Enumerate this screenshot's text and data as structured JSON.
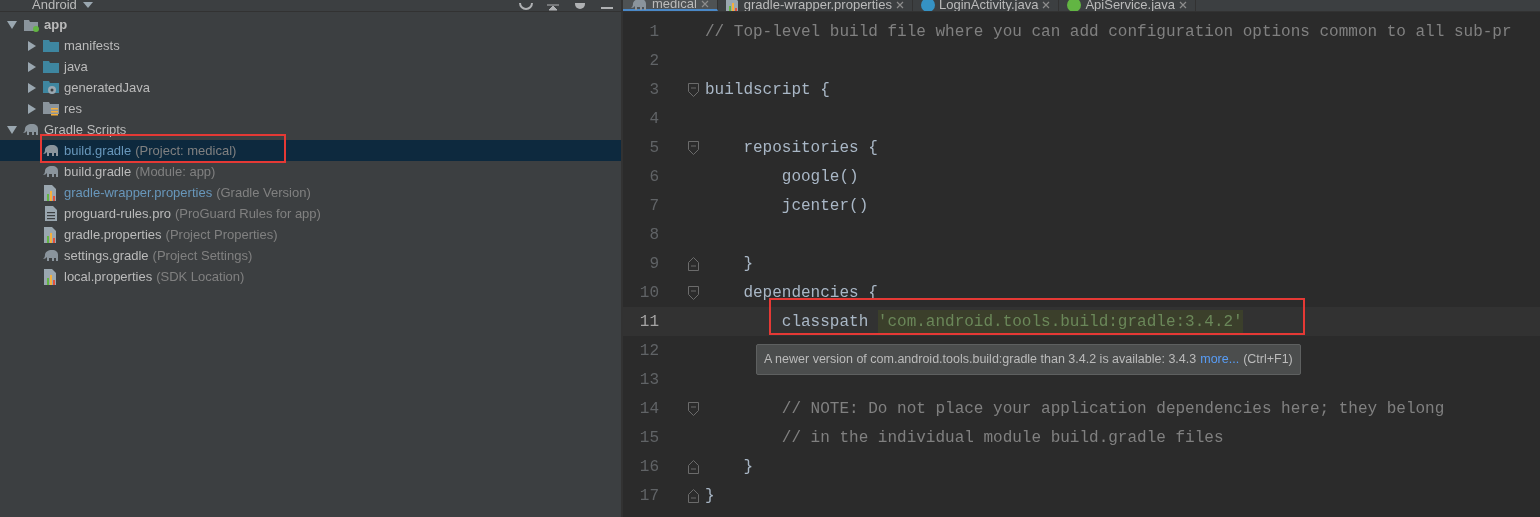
{
  "project_panel": {
    "view": "Android",
    "tree": [
      {
        "label": "app",
        "kind": "module",
        "bold": true,
        "expanded": true,
        "selected": false,
        "children": [
          {
            "label": "manifests",
            "kind": "folder",
            "expanded": false,
            "selected": false
          },
          {
            "label": "java",
            "kind": "folder",
            "expanded": false,
            "selected": false
          },
          {
            "label": "generatedJava",
            "kind": "generated",
            "expanded": false,
            "selected": false
          },
          {
            "label": "res",
            "kind": "res",
            "expanded": false,
            "selected": false
          }
        ]
      },
      {
        "label": "Gradle Scripts",
        "kind": "gradle",
        "bold": false,
        "expanded": true,
        "selected": false,
        "children": [
          {
            "label": "build.gradle",
            "hint": "(Project: medical)",
            "kind": "gradle",
            "modified": true,
            "selected": true,
            "highlighted": true
          },
          {
            "label": "build.gradle",
            "hint": "(Module: app)",
            "kind": "gradle",
            "modified": false,
            "selected": false
          },
          {
            "label": "gradle-wrapper.properties",
            "hint": "(Gradle Version)",
            "kind": "properties",
            "modified": true,
            "selected": false
          },
          {
            "label": "proguard-rules.pro",
            "hint": "(ProGuard Rules for app)",
            "kind": "file",
            "modified": false,
            "selected": false
          },
          {
            "label": "gradle.properties",
            "hint": "(Project Properties)",
            "kind": "properties",
            "modified": false,
            "selected": false
          },
          {
            "label": "settings.gradle",
            "hint": "(Project Settings)",
            "kind": "gradle",
            "modified": false,
            "selected": false
          },
          {
            "label": "local.properties",
            "hint": "(SDK Location)",
            "kind": "properties",
            "modified": false,
            "selected": false
          }
        ]
      }
    ]
  },
  "editor_tabs": [
    {
      "label": "medical",
      "kind": "gradle",
      "selected": true
    },
    {
      "label": "gradle-wrapper.properties",
      "kind": "properties",
      "selected": false
    },
    {
      "label": "LoginActivity.java",
      "kind": "class",
      "selected": false
    },
    {
      "label": "ApiService.java",
      "kind": "interface",
      "selected": false
    }
  ],
  "code": [
    {
      "number": "1",
      "segments": [
        {
          "kind": "comment",
          "text": "// Top-level build file where you can add configuration options common to all sub-pr"
        }
      ]
    },
    {
      "number": "2"
    },
    {
      "number": "3",
      "fold_start": true,
      "segments": [
        {
          "kind": "plain",
          "text": "buildscript {"
        }
      ]
    },
    {
      "number": "4"
    },
    {
      "number": "5",
      "fold_start": true,
      "segments": [
        {
          "kind": "plain",
          "text": "    repositories {"
        }
      ]
    },
    {
      "number": "6",
      "segments": [
        {
          "kind": "plain",
          "text": "        google()"
        }
      ]
    },
    {
      "number": "7",
      "segments": [
        {
          "kind": "plain",
          "text": "        jcenter()"
        }
      ]
    },
    {
      "number": "8"
    },
    {
      "number": "9",
      "fold_end": true,
      "segments": [
        {
          "kind": "plain",
          "text": "    }"
        }
      ]
    },
    {
      "number": "10",
      "fold_start": true,
      "segments": [
        {
          "kind": "plain",
          "text": "    dependencies {"
        }
      ]
    },
    {
      "number": "11",
      "current": true,
      "highlighted": true,
      "segments": [
        {
          "kind": "plain",
          "text": "        classpath "
        },
        {
          "kind": "warning-string",
          "text": "'com.android.tools.build:gradle:3.4.2'"
        }
      ]
    },
    {
      "number": "12"
    },
    {
      "number": "13"
    },
    {
      "number": "14",
      "fold_start": true,
      "segments": [
        {
          "kind": "comment",
          "text": "        // NOTE: Do not place your application dependencies here; they belong"
        }
      ]
    },
    {
      "number": "15",
      "segments": [
        {
          "kind": "comment",
          "text": "        // in the individual module build.gradle files"
        }
      ]
    },
    {
      "number": "16",
      "fold_end": true,
      "segments": [
        {
          "kind": "plain",
          "text": "    }"
        }
      ]
    },
    {
      "number": "17",
      "fold_end": true,
      "segments": [
        {
          "kind": "plain",
          "text": "}"
        }
      ]
    }
  ],
  "tooltip": {
    "text": "A newer version of com.android.tools.build:gradle than 3.4.2 is available: 3.4.3",
    "link": "more...",
    "shortcut": "(Ctrl+F1)"
  }
}
